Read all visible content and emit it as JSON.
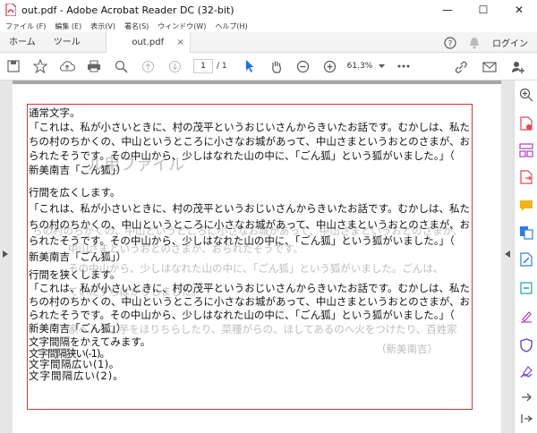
{
  "window": {
    "title": "out.pdf - Adobe Acrobat Reader DC (32-bit)",
    "controls": [
      "—",
      "☐",
      "✕"
    ]
  },
  "menu": [
    "ファイル (F)",
    "編集 (E)",
    "表示(V)",
    "署名(S)",
    "ウィンドウ(W)",
    "ヘルプ(H)"
  ],
  "tabs": {
    "home": "ホーム",
    "tools": "ツール",
    "doc": "out.pdf",
    "doc_close": "×",
    "login": "ログイン"
  },
  "toolbar": {
    "page_current": "1",
    "page_total": "/ 1",
    "zoom": "61.3%"
  },
  "document": {
    "paragraphs": [
      {
        "heading": "通常文字。",
        "lines": [
          "「これは、私が小さいときに、村の茂平というおじいさんからきいたお話です。むかしは、私た",
          "ちの村のちかくの、中山というところに小さなお城があって、中山さまというおとのさまが、お",
          "られたそうです。その中山から、少しはなれた山の中に、「ごん狐」という狐がいました。」（",
          "新美南吉「ごん狐」）"
        ]
      },
      {
        "heading": "行間を広くします。",
        "lines": [
          "「これは、私が小さいときに、村の茂平というおじいさんからきいたお話です。むかしは、私た",
          "ちの村のちかくの、中山というところに小さなお城があって、中山さまというおとのさまが、お",
          "られたそうです。その中山から、少しはなれた山の中に、「ごん狐」という狐がいました。」（",
          "新美南吉「ごん狐」）"
        ]
      },
      {
        "heading": "行間を狭くします。",
        "lines": [
          "「これは、私が小さいときに、村の茂平というおじいさんからきいたお話です。むかしは、私た",
          "ちの村のちかくの、中山というところに小さなお城があって、中山さまというおとのさまが、お",
          "られたそうです。その中山から、少しはなれた山の中に、「ごん狐」という狐がいました。」（",
          "新美南吉「ごん狐」）"
        ]
      }
    ],
    "spacing_lines": [
      "文字間隔をかえてみます。",
      "文字間隔狭い(-1)。",
      "文字間隔広い(1)。",
      "文字間隔広い(2)。"
    ],
    "background_texts": [
      "ル用ファイル",
      "ちの村のちかくの、中山というところに小さなお城があって、中山さまというおとのさまが、",
      "中山さまというおとのさまが、おられたそうです。",
      "その中山から、少しはなれた山の中に、「ごん狐」という狐がいました。ごんは、",
      "ていたずらばかりしました。",
      "家へ入って芋をほりちらしたり、菜種がらの、ほしてあるのへ火をつけたり、百姓家",
      "（新美南吉）"
    ]
  }
}
